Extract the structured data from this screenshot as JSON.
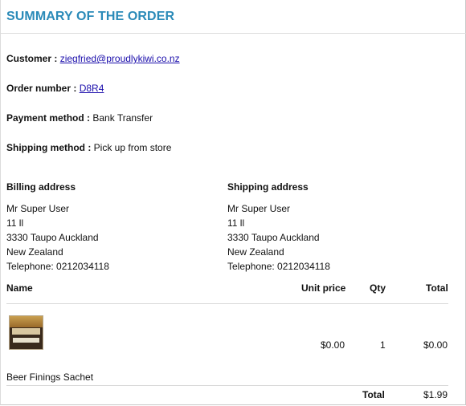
{
  "title": "SUMMARY OF THE ORDER",
  "order": {
    "customer_label": "Customer :",
    "customer_value": "ziegfried@proudlykiwi.co.nz",
    "order_number_label": "Order number :",
    "order_number_value": "D8R4",
    "payment_label": "Payment method :",
    "payment_value": "Bank Transfer",
    "shipping_method_label": "Shipping method :",
    "shipping_method_value": "Pick up from store"
  },
  "billing": {
    "heading": "Billing address",
    "lines": [
      "Mr Super User",
      "11 ll",
      "3330 Taupo Auckland",
      "New Zealand",
      "Telephone: 0212034118"
    ]
  },
  "shipping": {
    "heading": "Shipping address",
    "lines": [
      "Mr Super User",
      "11 ll",
      "3330 Taupo Auckland",
      "New Zealand",
      "Telephone: 0212034118"
    ]
  },
  "table": {
    "headers": {
      "name": "Name",
      "unit_price": "Unit price",
      "qty": "Qty",
      "total": "Total"
    },
    "items": [
      {
        "name": "Beer Finings Sachet",
        "unit_price": "$0.00",
        "qty": "1",
        "total": "$0.00",
        "image": "product-thumbnail"
      }
    ],
    "total_label": "Total",
    "total_value": "$1.99"
  }
}
